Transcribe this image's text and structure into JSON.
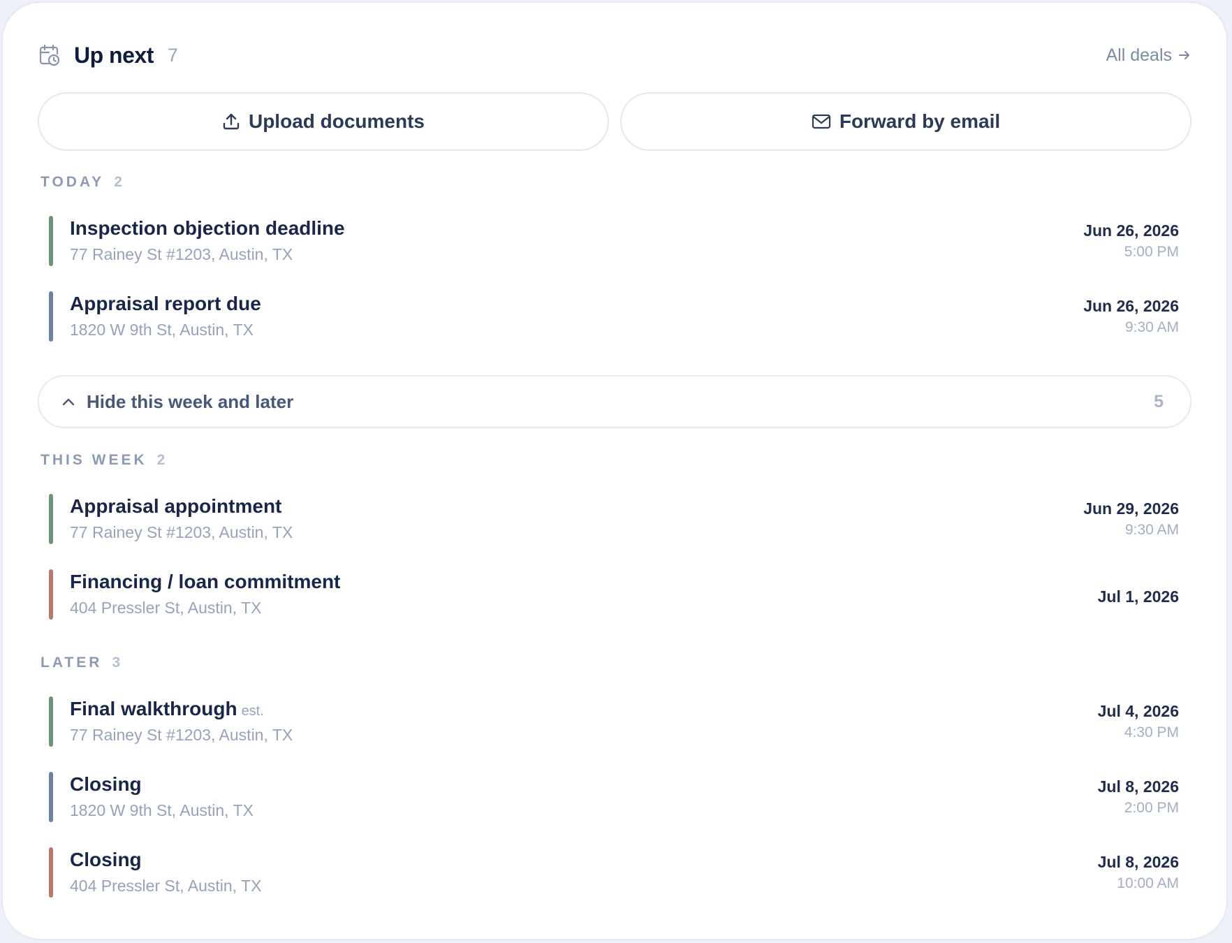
{
  "header": {
    "title": "Up next",
    "count": "7",
    "all_deals_label": "All deals"
  },
  "actions": {
    "upload_label": "Upload documents",
    "forward_label": "Forward by email"
  },
  "colors": {
    "green": "#6e957b",
    "slate": "#6f80a0",
    "rose": "#b57a70"
  },
  "sections": {
    "today": {
      "label": "TODAY",
      "count": "2",
      "items": [
        {
          "title": "Inspection objection deadline",
          "address": "77 Rainey St #1203, Austin, TX",
          "date": "Jun 26, 2026",
          "time": "5:00 PM",
          "color": "green"
        },
        {
          "title": "Appraisal report due",
          "address": "1820 W 9th St, Austin, TX",
          "date": "Jun 26, 2026",
          "time": "9:30 AM",
          "color": "slate"
        }
      ]
    },
    "this_week": {
      "label": "THIS WEEK",
      "count": "2",
      "items": [
        {
          "title": "Appraisal appointment",
          "address": "77 Rainey St #1203, Austin, TX",
          "date": "Jun 29, 2026",
          "time": "9:30 AM",
          "color": "green"
        },
        {
          "title": "Financing / loan commitment",
          "address": "404 Pressler St, Austin, TX",
          "date": "Jul 1, 2026",
          "time": "",
          "color": "rose"
        }
      ]
    },
    "later": {
      "label": "LATER",
      "count": "3",
      "items": [
        {
          "title": "Final walkthrough",
          "tag": "est.",
          "address": "77 Rainey St #1203, Austin, TX",
          "date": "Jul 4, 2026",
          "time": "4:30 PM",
          "color": "green"
        },
        {
          "title": "Closing",
          "address": "1820 W 9th St, Austin, TX",
          "date": "Jul 8, 2026",
          "time": "2:00 PM",
          "color": "slate"
        },
        {
          "title": "Closing",
          "address": "404 Pressler St, Austin, TX",
          "date": "Jul 8, 2026",
          "time": "10:00 AM",
          "color": "rose"
        }
      ]
    }
  },
  "toggle": {
    "label": "Hide this week and later",
    "count": "5"
  }
}
